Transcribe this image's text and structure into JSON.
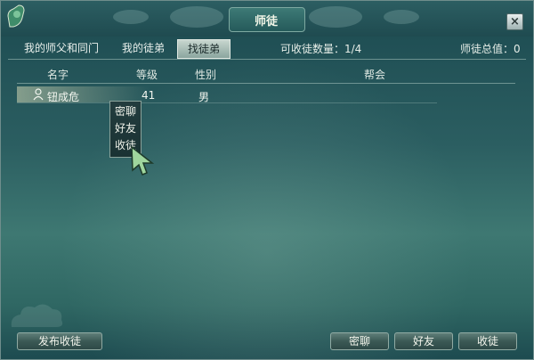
{
  "window": {
    "title": "师徒"
  },
  "tabs": [
    {
      "label": "我的师父和同门",
      "active": false
    },
    {
      "label": "我的徒弟",
      "active": false
    },
    {
      "label": "找徒弟",
      "active": true
    }
  ],
  "stats": {
    "recruitable": "可收徒数量：1/4",
    "total_value": "师徒总值：0"
  },
  "table": {
    "headers": [
      "名字",
      "等级",
      "性别",
      "帮会"
    ],
    "rows": [
      {
        "name": "钮成危",
        "level": "41",
        "gender": "男",
        "guild": ""
      }
    ]
  },
  "context_menu": {
    "items": [
      "密聊",
      "好友",
      "收徒"
    ]
  },
  "buttons": {
    "publish": "发布收徒",
    "chat": "密聊",
    "friend": "好友",
    "recruit": "收徒"
  },
  "icons": {
    "close": "close-icon",
    "gem": "jade-ornament-icon",
    "person": "person-icon"
  },
  "colors": {
    "accent": "#2b5e61",
    "text": "#f3f6ef"
  }
}
